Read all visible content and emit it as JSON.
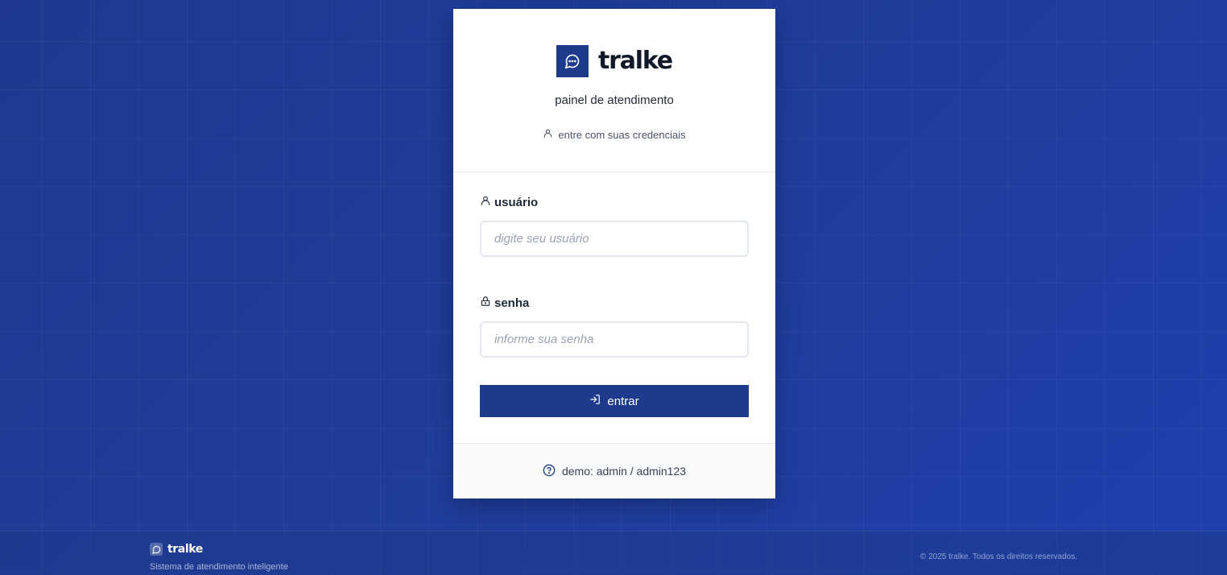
{
  "brand": {
    "name": "tralke",
    "accent": "#1e3a8a"
  },
  "login": {
    "subtitle": "painel de atendimento",
    "hint": "entre com suas credenciais",
    "username": {
      "label": "usuário",
      "placeholder": "digite seu usuário",
      "value": ""
    },
    "password": {
      "label": "senha",
      "placeholder": "informe sua senha",
      "value": ""
    },
    "submit_label": "entrar",
    "demo_text": "demo: admin / admin123"
  },
  "footer": {
    "brand": "tralke",
    "tagline": "Sistema de atendimento inteligente",
    "copyright": "© 2025 tralke. Todos os direitos reservados."
  },
  "icons": {
    "logo": "chat-bubble-icon",
    "hint": "user-icon",
    "username": "user-icon",
    "password": "lock-icon",
    "submit": "log-in-icon",
    "demo": "help-circle-icon"
  }
}
